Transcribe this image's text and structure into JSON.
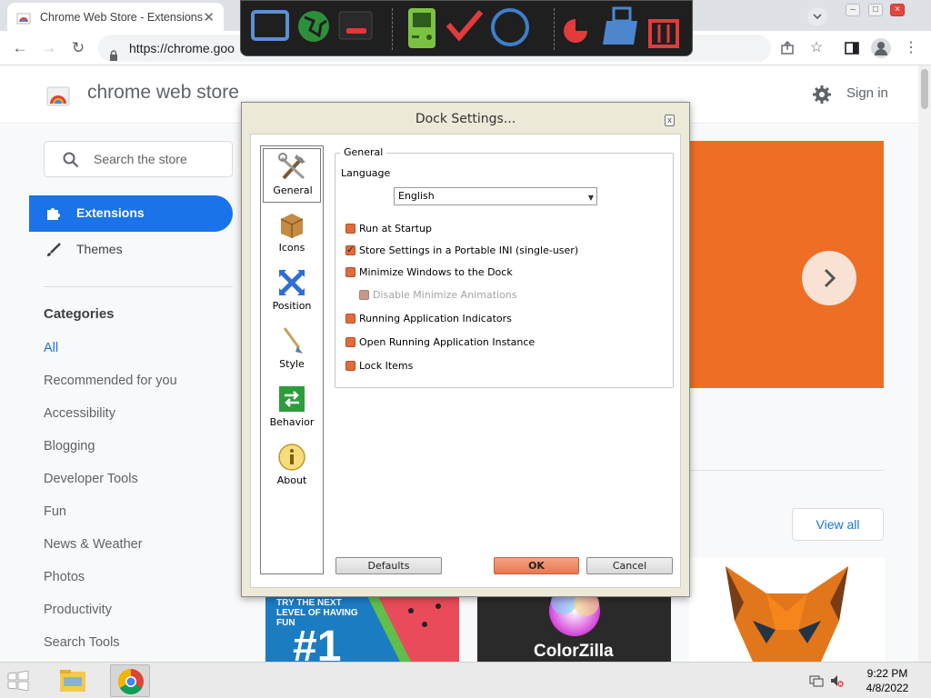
{
  "browser": {
    "tab_title": "Chrome Web Store - Extensions",
    "tab_close": "✕",
    "url": "https://chrome.goo",
    "back": "←",
    "forward": "→",
    "reload": "↻"
  },
  "store": {
    "title": "chrome web store",
    "sign_in": "Sign in",
    "search_placeholder": "Search the store",
    "nav": [
      {
        "label": "Extensions",
        "icon": "puzzle-icon"
      },
      {
        "label": "Themes",
        "icon": "brush-icon"
      }
    ],
    "categories_heading": "Categories",
    "categories": [
      "All",
      "Recommended for you",
      "Accessibility",
      "Blogging",
      "Developer Tools",
      "Fun",
      "News & Weather",
      "Photos",
      "Productivity",
      "Search Tools"
    ],
    "view_all": "View all",
    "card_text": {
      "card1_small": "TRY THE NEXT LEVEL OF HAVING FUN",
      "card1_big": "#1",
      "card2_name": "ColorZilla"
    },
    "accent_color": "#1a73e8",
    "banner_color": "#ee6e26"
  },
  "dock": {
    "icons": [
      "monitor-icon",
      "globe-icon",
      "terminal-icon",
      "gameboy-icon",
      "checkmark-icon",
      "circle-icon",
      "pie-icon",
      "shopping-bag-icon",
      "trash-icon"
    ]
  },
  "dialog": {
    "title": "Dock Settings...",
    "close": "x",
    "side_items": [
      {
        "label": "General",
        "icon": "tools-icon",
        "selected": true
      },
      {
        "label": "Icons",
        "icon": "box-icon",
        "selected": false
      },
      {
        "label": "Position",
        "icon": "position-icon",
        "selected": false
      },
      {
        "label": "Style",
        "icon": "brush-icon",
        "selected": false
      },
      {
        "label": "Behavior",
        "icon": "behavior-icon",
        "selected": false
      },
      {
        "label": "About",
        "icon": "info-icon",
        "selected": false
      }
    ],
    "group_title": "General",
    "language_label": "Language",
    "language_value": "English",
    "options": [
      {
        "label": "Run at Startup",
        "checked": false,
        "disabled": false
      },
      {
        "label": "Store Settings in a Portable INI (single-user)",
        "checked": true,
        "disabled": false
      },
      {
        "label": "Minimize Windows to the Dock",
        "checked": false,
        "disabled": false
      },
      {
        "label": "Disable Minimize Animations",
        "checked": false,
        "disabled": true
      },
      {
        "label": "Running Application Indicators",
        "checked": false,
        "disabled": false
      },
      {
        "label": "Open Running Application Instance",
        "checked": false,
        "disabled": false
      },
      {
        "label": "Lock Items",
        "checked": false,
        "disabled": false
      }
    ],
    "buttons": {
      "defaults": "Defaults",
      "ok": "OK",
      "cancel": "Cancel"
    }
  },
  "taskbar": {
    "time": "9:22 PM",
    "date": "4/8/2022"
  }
}
